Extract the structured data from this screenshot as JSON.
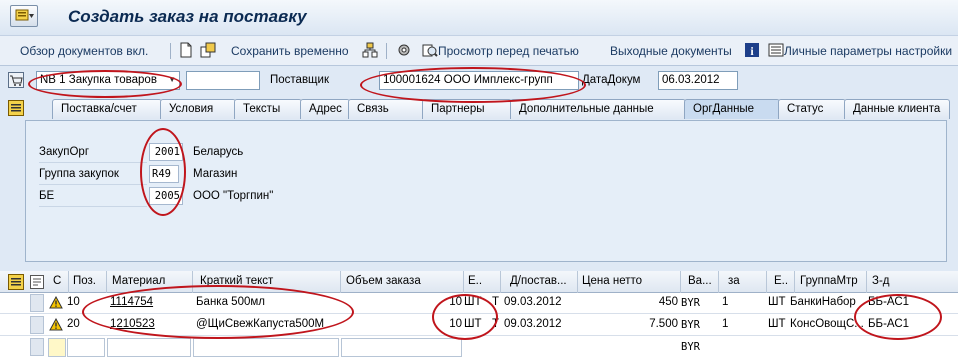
{
  "title": "Создать заказ на поставку",
  "toolbar": {
    "overview": "Обзор документов вкл.",
    "save_temp": "Сохранить временно",
    "print_preview": "Просмотр перед печатью",
    "output_docs": "Выходные документы",
    "personal_settings": "Личные параметры настройки"
  },
  "header": {
    "doc_type": "NB 1 Закупка товаров",
    "doc_number": "",
    "supplier_label": "Поставщик",
    "supplier_value": "100001624 ООО Имплекс-групп",
    "doc_date_label": "ДатаДокум",
    "doc_date_value": "06.03.2012"
  },
  "tabs": [
    "Поставка/счет",
    "Условия",
    "Тексты",
    "Адрес",
    "Связь",
    "Партнеры",
    "Дополнительные данные",
    "ОргДанные",
    "Статус",
    "Данные клиента"
  ],
  "org": {
    "purch_org_label": "ЗакупОрг",
    "purch_org_value": "2001",
    "purch_org_text": "Беларусь",
    "purch_group_label": "Группа закупок",
    "purch_group_value": "R49",
    "purch_group_text": "Магазин",
    "be_label": "БЕ",
    "be_value": "2005",
    "be_text": "ООО \"Торгпин\""
  },
  "grid": {
    "headers": {
      "c": "С",
      "pos": "Поз.",
      "material": "Материал",
      "short_text": "Краткий текст",
      "qty": "Объем заказа",
      "unit": "Е..",
      "date": "Д/постав...",
      "net_price": "Цена нетто",
      "currency": "Ва...",
      "per": "за",
      "unit2": "Е..",
      "mat_group": "ГруппаМтр",
      "plant": "З-д"
    },
    "rows": [
      {
        "pos": "10",
        "material": "1114754",
        "text": "Банка 500мл",
        "qty": "10",
        "unit": "ШТ",
        "t": "T",
        "date": "09.03.2012",
        "price": "450",
        "currency": "BYR",
        "per": "1",
        "unit2": "ШТ",
        "mat_group": "БанкиНабор",
        "plant": "ББ-АС1"
      },
      {
        "pos": "20",
        "material": "1210523",
        "text": "@ЩиСвежКапуста500М",
        "qty": "10",
        "unit": "ШТ",
        "t": "T",
        "date": "09.03.2012",
        "price": "7.500",
        "currency": "BYR",
        "per": "1",
        "unit2": "ШТ",
        "mat_group": "КонсОвощС...",
        "plant": "ББ-АС1"
      },
      {
        "pos": "",
        "material": "",
        "text": "",
        "qty": "",
        "unit": "",
        "t": "",
        "date": "",
        "price": "",
        "currency": "BYR",
        "per": "",
        "unit2": "",
        "mat_group": "",
        "plant": ""
      }
    ]
  },
  "colors": {
    "annotation": "#c0151c",
    "title": "#0b2a52",
    "warning": "#f5c400"
  }
}
